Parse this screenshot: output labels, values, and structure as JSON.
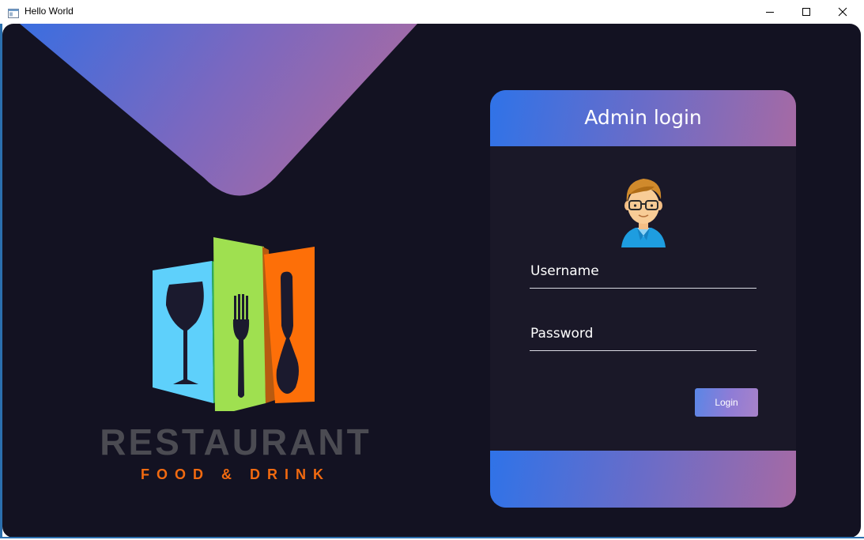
{
  "window": {
    "title": "Hello World",
    "icons": {
      "app": "window-app-icon",
      "minimize": "minimize-icon",
      "maximize": "maximize-icon",
      "close": "close-icon"
    }
  },
  "brand": {
    "name": "RESTAURANT",
    "tagline": "FOOD & DRINK",
    "logo_icons": [
      "wine-glass-icon",
      "fork-icon",
      "spoon-icon"
    ],
    "colors": {
      "panel_blue": "#5ed0fb",
      "panel_green": "#9fe050",
      "panel_orange": "#fd6f08",
      "name_gray": "#4b4b52",
      "tagline_orange": "#f26a10"
    }
  },
  "login": {
    "title": "Admin login",
    "username_placeholder": "Username",
    "password_placeholder": "Password",
    "login_label": "Login",
    "avatar_icon": "admin-avatar-icon"
  },
  "theme": {
    "background": "#131222",
    "card_background": "#1a1828",
    "gradient_start": "#2f73e8",
    "gradient_end": "#a66aa4"
  }
}
